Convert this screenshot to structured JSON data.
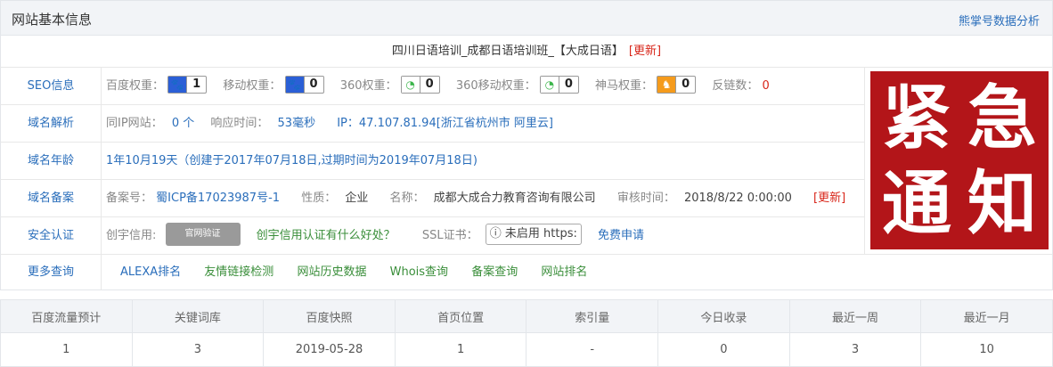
{
  "header": {
    "title": "网站基本信息",
    "right_link": "熊掌号数据分析"
  },
  "site_title": {
    "text": "四川日语培训_成都日语培训班_【大成日语】",
    "update": "[更新]"
  },
  "seo": {
    "label": "SEO信息",
    "baidu_label": "百度权重：",
    "baidu_value": "1",
    "mobile_label": "移动权重：",
    "mobile_value": "0",
    "w360_label": "360权重：",
    "w360_value": "0",
    "w360m_label": "360移动权重：",
    "w360m_value": "0",
    "shenma_label": "神马权重：",
    "shenma_value": "0",
    "backlinks_label": "反链数：",
    "backlinks_value": "0"
  },
  "dns": {
    "label": "域名解析",
    "same_ip_label": "同IP网站：",
    "same_ip_value": "0 个",
    "resp_label": "响应时间：",
    "resp_value": "53毫秒",
    "ip_text": "IP：47.107.81.94[浙江省杭州市 阿里云]"
  },
  "age": {
    "label": "域名年龄",
    "text": "1年10月19天（创建于2017年07月18日,过期时间为2019年07月18日)"
  },
  "icp": {
    "label": "域名备案",
    "no_label": "备案号：",
    "no_value": "蜀ICP备17023987号-1",
    "nature_label": "性质：",
    "nature_value": "企业",
    "name_label": "名称：",
    "name_value": "成都大成合力教育咨询有限公司",
    "audit_label": "审核时间：",
    "audit_value": "2018/8/22 0:00:00",
    "update": "[更新]"
  },
  "security": {
    "label": "安全认证",
    "cred_label": "创宇信用:",
    "seal_text": "官网验证",
    "cred_link": "创宇信用认证有什么好处？",
    "ssl_label": "SSL证书：",
    "ssl_box": "未启用 https:",
    "ssl_apply": "免费申请"
  },
  "notice": {
    "chars": [
      "紧",
      "急",
      "通",
      "知"
    ]
  },
  "more": {
    "label": "更多查询",
    "links": [
      "ALEXA排名",
      "友情链接检测",
      "网站历史数据",
      "Whois查询",
      "备案查询",
      "网站排名"
    ]
  },
  "stats": {
    "headers": [
      "百度流量预计",
      "关键词库",
      "百度快照",
      "首页位置",
      "索引量",
      "今日收录",
      "最近一周",
      "最近一月"
    ],
    "values": [
      "1",
      "3",
      "2019-05-28",
      "1",
      "-",
      "0",
      "3",
      "10"
    ]
  },
  "colors": {
    "link_blue": "#2a6ebb",
    "link_green": "#3a8e3a",
    "update_red": "#d8261a",
    "notice_red": "#b31519"
  }
}
